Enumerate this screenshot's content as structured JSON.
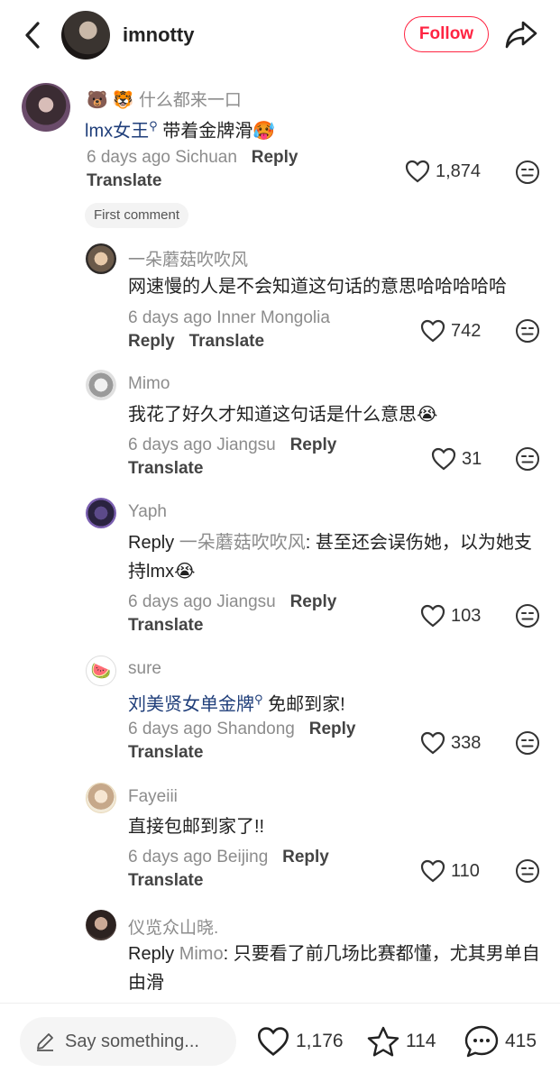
{
  "header": {
    "username": "imnotty",
    "follow_label": "Follow"
  },
  "comments": [
    {
      "name": "🐻 🐯 什么都来一口",
      "mention": "lmx女王",
      "text": " 带着金牌滑🥵",
      "meta": "6 days ago Sichuan",
      "reply": "Reply",
      "translate": "Translate",
      "likes": "1,874",
      "badge": "First comment"
    },
    {
      "name": "一朵蘑菇吹吹风",
      "text": "网速慢的人是不会知道这句话的意思哈哈哈哈哈",
      "meta": "6 days ago Inner Mongolia",
      "reply": "Reply",
      "translate": "Translate",
      "likes": "742"
    },
    {
      "name": "Mimo",
      "text": "我花了好久才知道这句话是什么意思😭",
      "meta": "6 days ago Jiangsu",
      "reply": "Reply",
      "translate": "Translate",
      "likes": "31"
    },
    {
      "name": "Yaph",
      "reply_prefix": "Reply",
      "reply_to": "一朵蘑菇吹吹风",
      "text": ": 甚至还会误伤她，以为她支持lmx😭",
      "meta": "6 days ago Jiangsu",
      "reply": "Reply",
      "translate": "Translate",
      "likes": "103"
    },
    {
      "name": "sure",
      "mention": "刘美贤女单金牌",
      "text": " 免邮到家!",
      "meta": "6 days ago Shandong",
      "reply": "Reply",
      "translate": "Translate",
      "likes": "338"
    },
    {
      "name": "Fayeiii",
      "text": "直接包邮到家了!!",
      "meta": "6 days ago Beijing",
      "reply": "Reply",
      "translate": "Translate",
      "likes": "110"
    },
    {
      "name": "仪览众山晓.",
      "reply_prefix": "Reply",
      "reply_to": "Mimo",
      "text": ": 只要看了前几场比赛都懂，尤其男单自由滑"
    }
  ],
  "bottom_bar": {
    "placeholder": "Say something...",
    "likes": "1,176",
    "stars": "114",
    "comments": "415"
  }
}
